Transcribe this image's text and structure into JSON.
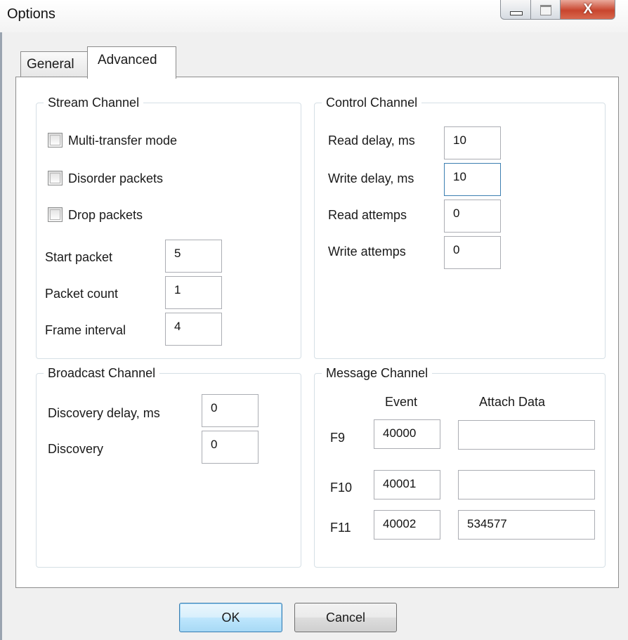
{
  "window": {
    "title": "Options",
    "close_glyph": "X",
    "icons": [
      "minimize-icon",
      "maximize-icon",
      "close-icon"
    ]
  },
  "tabs": {
    "general": "General",
    "advanced": "Advanced"
  },
  "stream_channel": {
    "title": "Stream Channel",
    "multi_transfer": {
      "label": "Multi-transfer mode",
      "checked": false
    },
    "disorder_packets": {
      "label": "Disorder packets",
      "checked": false
    },
    "drop_packets": {
      "label": "Drop packets",
      "checked": false
    },
    "start_packet": {
      "label": "Start packet",
      "value": "5"
    },
    "packet_count": {
      "label": "Packet count",
      "value": "1"
    },
    "frame_interval": {
      "label": "Frame interval",
      "value": "4"
    }
  },
  "control_channel": {
    "title": "Control Channel",
    "read_delay": {
      "label": "Read delay, ms",
      "value": "10"
    },
    "write_delay": {
      "label": "Write delay, ms",
      "value": "10"
    },
    "read_attemps": {
      "label": "Read attemps",
      "value": "0"
    },
    "write_attemps": {
      "label": "Write attemps",
      "value": "0"
    }
  },
  "broadcast_channel": {
    "title": "Broadcast Channel",
    "discovery_delay": {
      "label": "Discovery delay, ms",
      "value": "0"
    },
    "discovery": {
      "label": "Discovery",
      "value": "0"
    }
  },
  "message_channel": {
    "title": "Message Channel",
    "columns": {
      "event": "Event",
      "attach": "Attach Data"
    },
    "rows": [
      {
        "key": "F9",
        "event": "40000",
        "attach": ""
      },
      {
        "key": "F10",
        "event": "40001",
        "attach": ""
      },
      {
        "key": "F11",
        "event": "40002",
        "attach": "534577"
      }
    ]
  },
  "buttons": {
    "ok": "OK",
    "cancel": "Cancel"
  }
}
